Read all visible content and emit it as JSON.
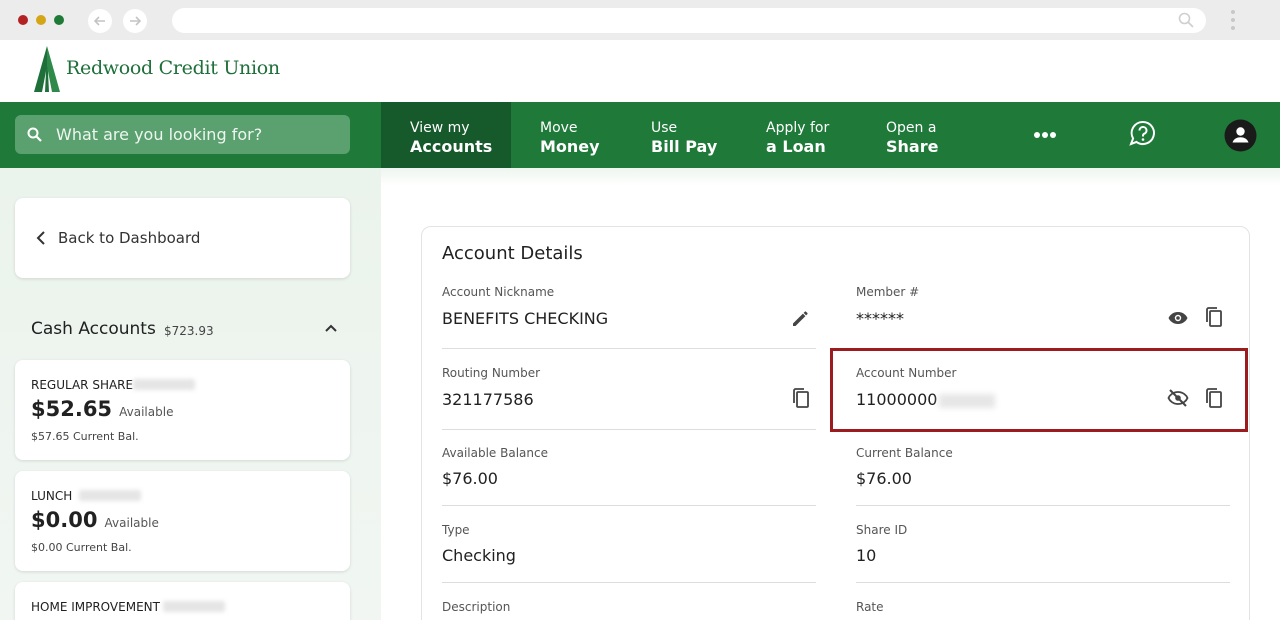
{
  "brand": {
    "name": "Redwood Credit Union",
    "color_primary": "#1f7a3a",
    "color_active": "#16592a",
    "highlight_color": "#9b1b1f"
  },
  "search": {
    "placeholder": "What are you looking for?"
  },
  "nav": {
    "items": [
      {
        "line1": "View my",
        "line2": "Accounts",
        "active": true
      },
      {
        "line1": "Move",
        "line2": "Money",
        "active": false
      },
      {
        "line1": "Use",
        "line2": "Bill Pay",
        "active": false
      },
      {
        "line1": "Apply for",
        "line2": "a Loan",
        "active": false
      },
      {
        "line1": "Open a",
        "line2": "Share",
        "active": false
      }
    ],
    "icons": [
      "more-icon",
      "help-chat-icon",
      "profile-icon"
    ]
  },
  "sidebar": {
    "back_label": "Back to Dashboard",
    "section_title": "Cash Accounts",
    "section_total": "$723.93",
    "accounts": [
      {
        "name": "REGULAR SHARE",
        "available": "$52.65",
        "available_label": "Available",
        "current": "$57.65 Current Bal."
      },
      {
        "name": "LUNCH",
        "available": "$0.00",
        "available_label": "Available",
        "current": "$0.00 Current Bal."
      },
      {
        "name": "HOME IMPROVEMENT"
      }
    ]
  },
  "details": {
    "title": "Account Details",
    "fields": {
      "nickname": {
        "label": "Account Nickname",
        "value": "BENEFITS CHECKING"
      },
      "member": {
        "label": "Member #",
        "value": "******"
      },
      "routing": {
        "label": "Routing Number",
        "value": "321177586"
      },
      "account_number": {
        "label": "Account Number",
        "value": "11000000"
      },
      "available_balance": {
        "label": "Available Balance",
        "value": "$76.00"
      },
      "current_balance": {
        "label": "Current Balance",
        "value": "$76.00"
      },
      "type": {
        "label": "Type",
        "value": "Checking"
      },
      "share_id": {
        "label": "Share ID",
        "value": "10"
      },
      "description": {
        "label": "Description"
      },
      "rate": {
        "label": "Rate"
      }
    }
  }
}
